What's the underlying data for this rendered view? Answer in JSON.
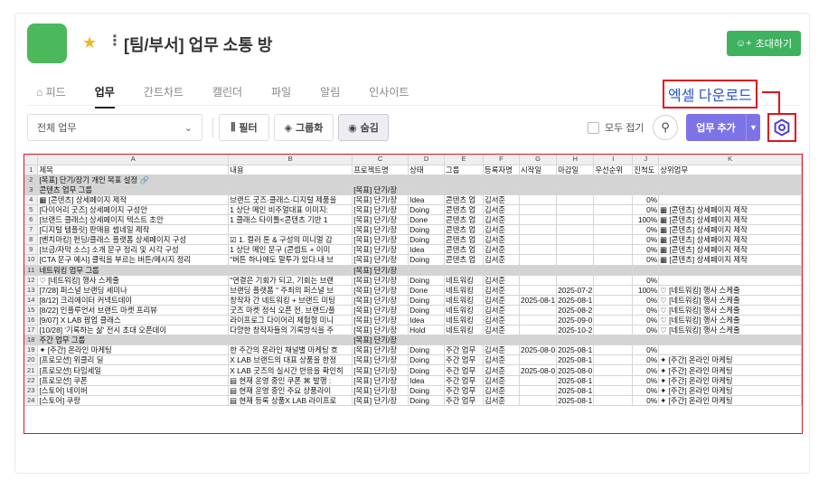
{
  "header": {
    "title": "[팀/부서] 업무 소통 방",
    "invite_label": "초대하기"
  },
  "tabs": [
    "피드",
    "업무",
    "간트차트",
    "캘린더",
    "파일",
    "알림",
    "인사이트"
  ],
  "callout": {
    "label": "엑셀 다운로드"
  },
  "toolbar": {
    "select_value": "전체 업무",
    "filter_label": "필터",
    "group_label": "그룹화",
    "hide_label": "숨김",
    "fold_label": "모두 접기",
    "add_label": "업무 추가"
  },
  "icons": {
    "gear": "settings-gear-icon",
    "search": "search-icon",
    "star": "star-icon"
  },
  "colors": {
    "accent": "#7c74e6",
    "invite": "#3fb25f",
    "callout": "#e0141e",
    "app_icon": "#4cb85c"
  },
  "sheet": {
    "col_letters": [
      "A",
      "B",
      "C",
      "D",
      "E",
      "F",
      "G",
      "H",
      "I",
      "J",
      "K"
    ],
    "rows": [
      {
        "n": "1",
        "cells": [
          "제목",
          "내용",
          "프로젝트명",
          "상태",
          "그룹",
          "등록자명",
          "시작일",
          "마감일",
          "우선순위",
          "진척도",
          "상위업무"
        ]
      },
      {
        "n": "2",
        "group": true,
        "cells": [
          "[목표] 단기/장기 개인 목표 설정 🔗",
          "",
          "",
          "",
          "",
          "",
          "",
          "",
          "",
          "",
          ""
        ]
      },
      {
        "n": "3",
        "group": true,
        "cells": [
          "콘텐츠 업무 그룹",
          "",
          "[목표] 단기/장",
          "",
          "",
          "",
          "",
          "",
          "",
          "",
          ""
        ]
      },
      {
        "n": "4",
        "cells": [
          "▦ [콘텐츠] 상세페이지 제작",
          "브랜드 굿즈·클래스·디지털 제품을",
          "[목표] 단기/장",
          "Idea",
          "콘텐츠 업",
          "김서준",
          "",
          "",
          "",
          "0%",
          ""
        ]
      },
      {
        "n": "5",
        "cells": [
          "[다이어리 굿즈] 상세페이지 구성안",
          "1 상단 메인 비주얼대표 이미지:",
          "[목표] 단기/장",
          "Doing",
          "콘텐츠 업",
          "김서준",
          "",
          "",
          "",
          "0%",
          "▦ [콘텐츠] 상세페이지 제작"
        ]
      },
      {
        "n": "6",
        "cells": [
          "[브랜드 클래스] 상세페이지 텍스트 초안",
          "1 클래스 타이틀<콘텐츠 기반 1",
          "[목표] 단기/장",
          "Done",
          "콘텐츠 업",
          "김서준",
          "",
          "",
          "",
          "100%",
          "▦ [콘텐츠] 상세페이지 제작"
        ]
      },
      {
        "n": "7",
        "cells": [
          "[디지털 템플릿] 판매용 썸네일 제작",
          "",
          "[목표] 단기/장",
          "Doing",
          "콘텐츠 업",
          "김서준",
          "",
          "",
          "",
          "0%",
          "▦ [콘텐츠] 상세페이지 제작"
        ]
      },
      {
        "n": "8",
        "cells": [
          "[벤치마킹] 펀딩/클래스 플랫폼 상세페이지 구성",
          "☑ 1. 컬러 톤 & 구성의 미니멀 감",
          "[목표] 단기/장",
          "Doing",
          "콘텐츠 업",
          "김서준",
          "",
          "",
          "",
          "0%",
          "▦ [콘텐츠] 상세페이지 제작"
        ]
      },
      {
        "n": "9",
        "cells": [
          "[브금/자막 소스] 소개 문구 정리 및 시각 구성",
          "1 상단 메인 문구 (콘셉트 + 이미",
          "[목표] 단기/장",
          "Idea",
          "콘텐츠 업",
          "김서준",
          "",
          "",
          "",
          "0%",
          "▦ [콘텐츠] 상세페이지 제작"
        ]
      },
      {
        "n": "10",
        "cells": [
          "[CTA 문구 예시] 클릭을 부르는 버튼/메시지 정리",
          "\"버튼 하나에도 말투가 있다.내 브",
          "[목표] 단기/장",
          "Doing",
          "콘텐츠 업",
          "김서준",
          "",
          "",
          "",
          "0%",
          "▦ [콘텐츠] 상세페이지 제작"
        ]
      },
      {
        "n": "11",
        "group": true,
        "cells": [
          "네트워킹 업무 그룹",
          "",
          "[목표] 단기/장",
          "",
          "",
          "",
          "",
          "",
          "",
          "",
          ""
        ]
      },
      {
        "n": "12",
        "cells": [
          "♡ [네트워킹] 행사 스케줄",
          "\"연결은 기회가 되고, 기회는 브랜",
          "[목표] 단기/장",
          "Doing",
          "네트워킹",
          "김서준",
          "",
          "",
          "",
          "0%",
          ""
        ]
      },
      {
        "n": "13",
        "cells": [
          "[7/28] 퍼스널 브랜딩 세미나",
          "브랜딩 플랫폼 \" 주최의 퍼스널 브",
          "[목표] 단기/장",
          "Done",
          "네트워킹",
          "김서준",
          "",
          "2025-07-2",
          "",
          "100%",
          "♡ [네트워킹] 행사 스케줄"
        ]
      },
      {
        "n": "14",
        "cells": [
          "[8/12] 크리에이터 커넥트데이",
          "창작자 간 네트워킹 + 브랜드 미팅",
          "[목표] 단기/장",
          "Doing",
          "네트워킹",
          "김서준",
          "2025-08-1",
          "2025-08-1",
          "",
          "0%",
          "♡ [네트워킹] 행사 스케줄"
        ]
      },
      {
        "n": "15",
        "cells": [
          "[8/22] 인플루언서 브랜드 마켓 프리뷰",
          "굿즈 마켓 정식 오픈 전, 브랜드/플",
          "[목표] 단기/장",
          "Doing",
          "네트워킹",
          "김서준",
          "",
          "2025-08-2",
          "",
          "0%",
          "♡ [네트워킹] 행사 스케줄"
        ]
      },
      {
        "n": "16",
        "cells": [
          "[9/07] X LAB 팝업 클래스",
          "라이프로그 다이어리 체험형 미니",
          "[목표] 단기/장",
          "Idea",
          "네트워킹",
          "김서준",
          "",
          "2025-09-0",
          "",
          "0%",
          "♡ [네트워킹] 행사 스케줄"
        ]
      },
      {
        "n": "17",
        "cells": [
          "[10/28] '기록하는 삶' 전시 초대 오픈데이",
          "다양한 창작자들의 기록방식을 주",
          "[목표] 단기/장",
          "Hold",
          "네트워킹",
          "김서준",
          "",
          "2025-10-2",
          "",
          "0%",
          "♡ [네트워킹] 행사 스케줄"
        ]
      },
      {
        "n": "18",
        "group": true,
        "cells": [
          "주간 업무 그룹",
          "",
          "[목표] 단기/장",
          "",
          "",
          "",
          "",
          "",
          "",
          "",
          ""
        ]
      },
      {
        "n": "19",
        "cells": [
          "✦ [주간] 온라인 마케팅",
          "한 주간의 온라인 채널별 마케팅 흐",
          "[목표] 단기/장",
          "Doing",
          "주간 업무",
          "김서준",
          "2025-08-0",
          "2025-08-1",
          "",
          "0%",
          ""
        ]
      },
      {
        "n": "20",
        "cells": [
          "[프로모션] 위클리 딜",
          "X LAB 브랜드의 대표 상품을 한정",
          "[목표] 단기/장",
          "Doing",
          "주간 업무",
          "김서준",
          "",
          "2025-08-1",
          "",
          "0%",
          "✦ [주간] 온라인 마케팅"
        ]
      },
      {
        "n": "21",
        "cells": [
          "[프로모션] 타임세일",
          "X LAB 굿즈의 실시간 반응을 확인히",
          "[목표] 단기/장",
          "Doing",
          "주간 업무",
          "김서준",
          "2025-08-0",
          "2025-08-0",
          "",
          "0%",
          "✦ [주간] 온라인 마케팅"
        ]
      },
      {
        "n": "22",
        "cells": [
          "[프로모션] 쿠폰",
          "▤ 현재 운영 중인 쿠폰 ⌘ 발행 :",
          "[목표] 단기/장",
          "Idea",
          "주간 업무",
          "김서준",
          "",
          "2025-08-1",
          "",
          "0%",
          "✦ [주간] 온라인 마케팅"
        ]
      },
      {
        "n": "23",
        "cells": [
          "[스토어] 네이버",
          "▤ 현재 운영 중인 주요 상품라이",
          "[목표] 단기/장",
          "Doing",
          "주간 업무",
          "김서준",
          "",
          "2025-08-1",
          "",
          "0%",
          "✦ [주간] 온라인 마케팅"
        ]
      },
      {
        "n": "24",
        "cells": [
          "[스토어] 쿠팡",
          "▤ 현재 등록 상품X LAB 라이프로",
          "[목표] 단기/장",
          "Doing",
          "주간 업무",
          "김서준",
          "",
          "2025-08-1",
          "",
          "0%",
          "✦ [주간] 온라인 마케팅"
        ]
      }
    ]
  }
}
